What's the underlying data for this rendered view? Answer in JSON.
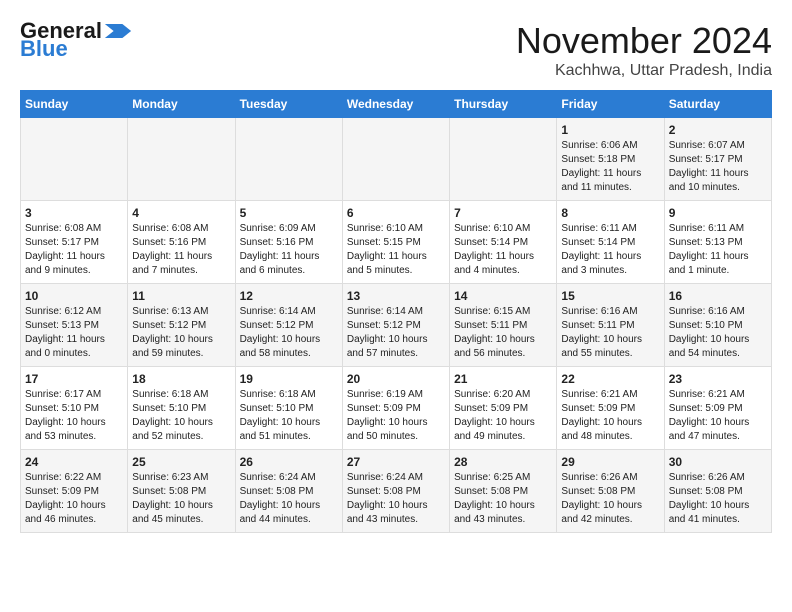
{
  "header": {
    "logo_line1": "General",
    "logo_line2": "Blue",
    "month_title": "November 2024",
    "location": "Kachhwa, Uttar Pradesh, India"
  },
  "days_of_week": [
    "Sunday",
    "Monday",
    "Tuesday",
    "Wednesday",
    "Thursday",
    "Friday",
    "Saturday"
  ],
  "weeks": [
    [
      {
        "day": "",
        "info": ""
      },
      {
        "day": "",
        "info": ""
      },
      {
        "day": "",
        "info": ""
      },
      {
        "day": "",
        "info": ""
      },
      {
        "day": "",
        "info": ""
      },
      {
        "day": "1",
        "info": "Sunrise: 6:06 AM\nSunset: 5:18 PM\nDaylight: 11 hours and 11 minutes."
      },
      {
        "day": "2",
        "info": "Sunrise: 6:07 AM\nSunset: 5:17 PM\nDaylight: 11 hours and 10 minutes."
      }
    ],
    [
      {
        "day": "3",
        "info": "Sunrise: 6:08 AM\nSunset: 5:17 PM\nDaylight: 11 hours and 9 minutes."
      },
      {
        "day": "4",
        "info": "Sunrise: 6:08 AM\nSunset: 5:16 PM\nDaylight: 11 hours and 7 minutes."
      },
      {
        "day": "5",
        "info": "Sunrise: 6:09 AM\nSunset: 5:16 PM\nDaylight: 11 hours and 6 minutes."
      },
      {
        "day": "6",
        "info": "Sunrise: 6:10 AM\nSunset: 5:15 PM\nDaylight: 11 hours and 5 minutes."
      },
      {
        "day": "7",
        "info": "Sunrise: 6:10 AM\nSunset: 5:14 PM\nDaylight: 11 hours and 4 minutes."
      },
      {
        "day": "8",
        "info": "Sunrise: 6:11 AM\nSunset: 5:14 PM\nDaylight: 11 hours and 3 minutes."
      },
      {
        "day": "9",
        "info": "Sunrise: 6:11 AM\nSunset: 5:13 PM\nDaylight: 11 hours and 1 minute."
      }
    ],
    [
      {
        "day": "10",
        "info": "Sunrise: 6:12 AM\nSunset: 5:13 PM\nDaylight: 11 hours and 0 minutes."
      },
      {
        "day": "11",
        "info": "Sunrise: 6:13 AM\nSunset: 5:12 PM\nDaylight: 10 hours and 59 minutes."
      },
      {
        "day": "12",
        "info": "Sunrise: 6:14 AM\nSunset: 5:12 PM\nDaylight: 10 hours and 58 minutes."
      },
      {
        "day": "13",
        "info": "Sunrise: 6:14 AM\nSunset: 5:12 PM\nDaylight: 10 hours and 57 minutes."
      },
      {
        "day": "14",
        "info": "Sunrise: 6:15 AM\nSunset: 5:11 PM\nDaylight: 10 hours and 56 minutes."
      },
      {
        "day": "15",
        "info": "Sunrise: 6:16 AM\nSunset: 5:11 PM\nDaylight: 10 hours and 55 minutes."
      },
      {
        "day": "16",
        "info": "Sunrise: 6:16 AM\nSunset: 5:10 PM\nDaylight: 10 hours and 54 minutes."
      }
    ],
    [
      {
        "day": "17",
        "info": "Sunrise: 6:17 AM\nSunset: 5:10 PM\nDaylight: 10 hours and 53 minutes."
      },
      {
        "day": "18",
        "info": "Sunrise: 6:18 AM\nSunset: 5:10 PM\nDaylight: 10 hours and 52 minutes."
      },
      {
        "day": "19",
        "info": "Sunrise: 6:18 AM\nSunset: 5:10 PM\nDaylight: 10 hours and 51 minutes."
      },
      {
        "day": "20",
        "info": "Sunrise: 6:19 AM\nSunset: 5:09 PM\nDaylight: 10 hours and 50 minutes."
      },
      {
        "day": "21",
        "info": "Sunrise: 6:20 AM\nSunset: 5:09 PM\nDaylight: 10 hours and 49 minutes."
      },
      {
        "day": "22",
        "info": "Sunrise: 6:21 AM\nSunset: 5:09 PM\nDaylight: 10 hours and 48 minutes."
      },
      {
        "day": "23",
        "info": "Sunrise: 6:21 AM\nSunset: 5:09 PM\nDaylight: 10 hours and 47 minutes."
      }
    ],
    [
      {
        "day": "24",
        "info": "Sunrise: 6:22 AM\nSunset: 5:09 PM\nDaylight: 10 hours and 46 minutes."
      },
      {
        "day": "25",
        "info": "Sunrise: 6:23 AM\nSunset: 5:08 PM\nDaylight: 10 hours and 45 minutes."
      },
      {
        "day": "26",
        "info": "Sunrise: 6:24 AM\nSunset: 5:08 PM\nDaylight: 10 hours and 44 minutes."
      },
      {
        "day": "27",
        "info": "Sunrise: 6:24 AM\nSunset: 5:08 PM\nDaylight: 10 hours and 43 minutes."
      },
      {
        "day": "28",
        "info": "Sunrise: 6:25 AM\nSunset: 5:08 PM\nDaylight: 10 hours and 43 minutes."
      },
      {
        "day": "29",
        "info": "Sunrise: 6:26 AM\nSunset: 5:08 PM\nDaylight: 10 hours and 42 minutes."
      },
      {
        "day": "30",
        "info": "Sunrise: 6:26 AM\nSunset: 5:08 PM\nDaylight: 10 hours and 41 minutes."
      }
    ]
  ]
}
